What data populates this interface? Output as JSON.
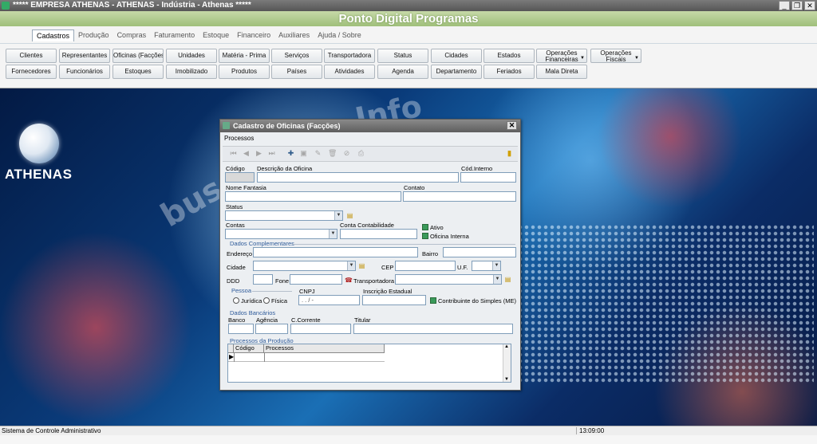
{
  "window": {
    "title": "***** EMPRESA ATHENAS -   ATHENAS - Indústria - Athenas *****"
  },
  "header": {
    "title": "Ponto Digital Programas"
  },
  "menu": {
    "tabs": [
      "Cadastros",
      "Produção",
      "Compras",
      "Faturamento",
      "Estoque",
      "Financeiro",
      "Auxiliares",
      "Ajuda / Sobre"
    ],
    "active": "Cadastros"
  },
  "ribbon": {
    "row1": [
      "Clientes",
      "Representantes",
      "Oficinas (Facções)",
      "Unidades",
      "Matéria - Prima",
      "Serviços",
      "Transportadora",
      "Status",
      "Cidades",
      "Estados"
    ],
    "row1_extra": [
      {
        "line1": "Operações",
        "line2": "Financeiras"
      },
      {
        "line1": "Operações",
        "line2": "Fiscais"
      }
    ],
    "row2": [
      "Fornecedores",
      "Funcionários",
      "Estoques",
      "Imobilizado",
      "Produtos",
      "Países",
      "Atividades",
      "Agenda",
      "Departamento",
      "Feriados",
      "Mala Direta"
    ]
  },
  "desktop": {
    "logo_text": "ATHENAS",
    "bg_words": [
      "Info",
      "bus"
    ]
  },
  "dialog": {
    "title": "Cadastro de Oficinas (Facções)",
    "menu_label": "Processos",
    "labels": {
      "codigo": "Código",
      "descricao": "Descrição da Oficina",
      "cod_interno": "Cód.Interno",
      "nome_fantasia": "Nome Fantasia",
      "contato": "Contato",
      "status": "Status",
      "contas": "Contas",
      "conta_contabilidade": "Conta Contabilidade",
      "ativo": "Ativo",
      "oficina_interna": "Oficina Interna",
      "dados_complementares": "Dados Complementares",
      "endereco": "Endereço",
      "bairro": "Bairro",
      "cidade": "Cidade",
      "cep": "CEP",
      "uf": "U.F.",
      "ddd": "DDD",
      "fone": "Fone",
      "transportadora": "Transportadora",
      "pessoa": "Pessoa",
      "juridica": "Jurídica",
      "fisica": "Física",
      "cnpj": "CNPJ",
      "inscricao_estadual": "Inscrição Estadual",
      "contribuinte_simples": "Contribuinte do Simples (ME)",
      "dados_bancarios": "Dados Bancários",
      "banco": "Banco",
      "agencia": "Agência",
      "c_corrente": "C.Corrente",
      "titular": "Titular",
      "processos_producao": "Processos da Produção"
    },
    "cnpj_mask": " .  .  /   -",
    "grid_columns": [
      "Código",
      "Processos"
    ]
  },
  "statusbar": {
    "left": "Sistema de Controle Administrativo",
    "time": "13:09:00"
  }
}
